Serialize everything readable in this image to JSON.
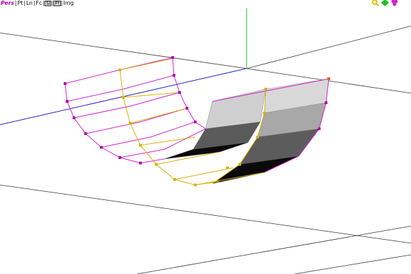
{
  "viewport": {
    "mode_label": "Pers",
    "tools": [
      {
        "label": "Pt",
        "boxed": false
      },
      {
        "label": "Ln",
        "boxed": false
      },
      {
        "label": "Fc",
        "boxed": false
      },
      {
        "label": "Sl",
        "boxed": true
      },
      {
        "label": "Ff",
        "boxed": true
      },
      {
        "label": "Img",
        "boxed": false
      }
    ],
    "separator": "|"
  },
  "nav_icons": [
    "zoom-icon",
    "move-icon",
    "rotate-icon"
  ],
  "colors": {
    "background": "#ffffff",
    "grid_line": "#333333",
    "axis_x": "#2020c0",
    "axis_y": "#20b020",
    "cage_magenta": "#d020d0",
    "cage_yellow": "#d8b000",
    "surface_light": "#e0e0e0",
    "surface_dark": "#000000",
    "nav_zoom": "#e0c000",
    "nav_move": "#20c020",
    "nav_rotate": "#d020d0"
  }
}
